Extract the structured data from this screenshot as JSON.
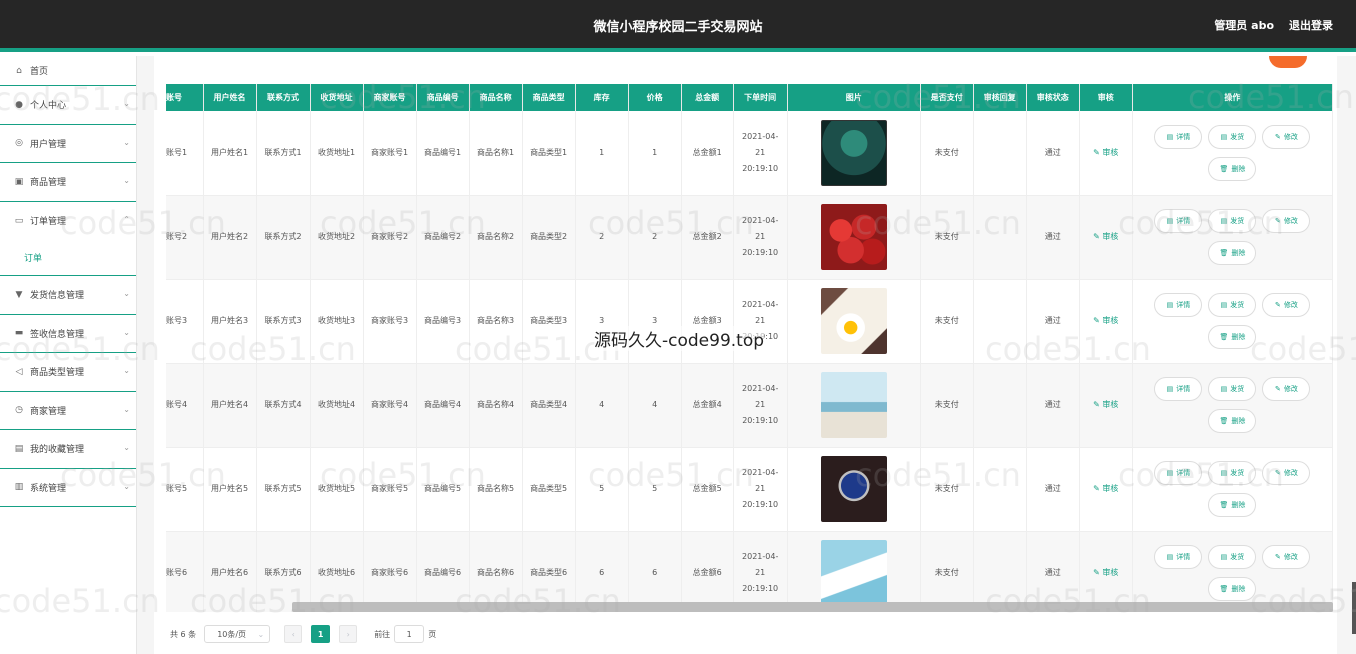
{
  "header": {
    "title": "微信小程序校园二手交易网站",
    "user": "管理员 abo",
    "logout": "退出登录"
  },
  "sidebar": {
    "items": [
      {
        "label": "首页",
        "icon": "home-icon",
        "glyph": "⌂"
      },
      {
        "label": "个人中心",
        "icon": "user-icon",
        "glyph": "●"
      },
      {
        "label": "用户管理",
        "icon": "users-icon",
        "glyph": "◎"
      },
      {
        "label": "商品管理",
        "icon": "goods-icon",
        "glyph": "▣"
      },
      {
        "label": "订单管理",
        "icon": "order-icon",
        "glyph": "▭"
      },
      {
        "label": "发货信息管理",
        "icon": "shipping-icon",
        "glyph": "▼"
      },
      {
        "label": "签收信息管理",
        "icon": "receipt-icon",
        "glyph": "▬"
      },
      {
        "label": "商品类型管理",
        "icon": "category-icon",
        "glyph": "◁"
      },
      {
        "label": "商家管理",
        "icon": "merchant-icon",
        "glyph": "◷"
      },
      {
        "label": "我的收藏管理",
        "icon": "favorite-icon",
        "glyph": "▤"
      },
      {
        "label": "系统管理",
        "icon": "system-icon",
        "glyph": "▥"
      }
    ],
    "sub_order": "订单"
  },
  "table": {
    "columns": [
      "账号",
      "用户姓名",
      "联系方式",
      "收货地址",
      "商家账号",
      "商品编号",
      "商品名称",
      "商品类型",
      "库存",
      "价格",
      "总金额",
      "下单时间",
      "图片",
      "是否支付",
      "审核回复",
      "审核状态",
      "审核",
      "操作"
    ],
    "rows": [
      {
        "account": "账号1",
        "name": "用户姓名1",
        "contact": "联系方式1",
        "address": "收货地址1",
        "merchant": "商家账号1",
        "goods_no": "商品编号1",
        "goods_name": "商品名称1",
        "goods_type": "商品类型1",
        "stock": "1",
        "price": "1",
        "total": "总金额1",
        "time": "2021-04-21 20:19:10",
        "paid": "未支付",
        "reply": "",
        "status": "通过",
        "image": "phone-image"
      },
      {
        "account": "账号2",
        "name": "用户姓名2",
        "contact": "联系方式2",
        "address": "收货地址2",
        "merchant": "商家账号2",
        "goods_no": "商品编号2",
        "goods_name": "商品名称2",
        "goods_type": "商品类型2",
        "stock": "2",
        "price": "2",
        "total": "总金额2",
        "time": "2021-04-21 20:19:10",
        "paid": "未支付",
        "reply": "",
        "status": "通过",
        "image": "cherries-image"
      },
      {
        "account": "账号3",
        "name": "用户姓名3",
        "contact": "联系方式3",
        "address": "收货地址3",
        "merchant": "商家账号3",
        "goods_no": "商品编号3",
        "goods_name": "商品名称3",
        "goods_type": "商品类型3",
        "stock": "3",
        "price": "3",
        "total": "总金额3",
        "time": "2021-04-21 20:19:10",
        "paid": "未支付",
        "reply": "",
        "status": "通过",
        "image": "bento-image"
      },
      {
        "account": "账号4",
        "name": "用户姓名4",
        "contact": "联系方式4",
        "address": "收货地址4",
        "merchant": "商家账号4",
        "goods_no": "商品编号4",
        "goods_name": "商品名称4",
        "goods_type": "商品类型4",
        "stock": "4",
        "price": "4",
        "total": "总金额4",
        "time": "2021-04-21 20:19:10",
        "paid": "未支付",
        "reply": "",
        "status": "通过",
        "image": "dress-image"
      },
      {
        "account": "账号5",
        "name": "用户姓名5",
        "contact": "联系方式5",
        "address": "收货地址5",
        "merchant": "商家账号5",
        "goods_no": "商品编号5",
        "goods_name": "商品名称5",
        "goods_type": "商品类型5",
        "stock": "5",
        "price": "5",
        "total": "总金额5",
        "time": "2021-04-21 20:19:10",
        "paid": "未支付",
        "reply": "",
        "status": "通过",
        "image": "watch-image"
      },
      {
        "account": "账号6",
        "name": "用户姓名6",
        "contact": "联系方式6",
        "address": "收货地址6",
        "merchant": "商家账号6",
        "goods_no": "商品编号6",
        "goods_name": "商品名称6",
        "goods_type": "商品类型6",
        "stock": "6",
        "price": "6",
        "total": "总金额6",
        "time": "2021-04-21 20:19:10",
        "paid": "未支付",
        "reply": "",
        "status": "通过",
        "image": "sneaker-image"
      }
    ],
    "audit_label": "审核",
    "ops": {
      "detail": "详情",
      "ship": "发货",
      "edit": "修改",
      "delete": "删除"
    }
  },
  "pager": {
    "total": "共 6 条",
    "page_size": "10条/页",
    "current": "1",
    "goto_prefix": "前往",
    "goto_value": "1",
    "goto_suffix": "页"
  },
  "watermarks": {
    "site": "code51.cn",
    "center": "源码久久-code99.top"
  },
  "colors": {
    "accent": "#16a085",
    "header": "#262626",
    "add_button": "#f56c2c"
  }
}
